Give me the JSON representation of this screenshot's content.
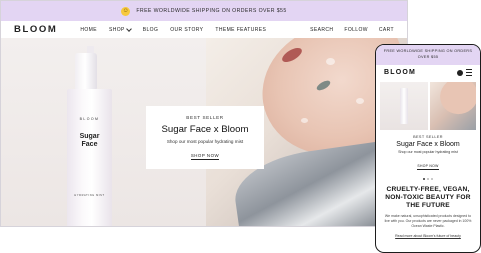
{
  "colors": {
    "announcement_bg": "#e3d5f3",
    "text": "#111111",
    "frame": "#1c1c1c"
  },
  "desktop": {
    "announcement": {
      "icon": "smile-emoji-icon",
      "text": "FREE WORLDWIDE SHIPPING ON ORDERS OVER $55"
    },
    "nav": {
      "logo": "BLOOM",
      "links": [
        "HOME",
        "SHOP",
        "BLOG",
        "OUR STORY",
        "THEME FEATURES"
      ],
      "right_links": [
        "SEARCH",
        "FOLLOW",
        "CART"
      ]
    },
    "product": {
      "brand": "BLOOM",
      "name_line1": "Sugar",
      "name_line2": "Face",
      "type": "HYDRATING MIST"
    },
    "hero": {
      "eyebrow": "BEST SELLER",
      "title": "Sugar Face x Bloom",
      "subtitle": "Shop our most popular hydrating mist",
      "cta": "SHOP NOW"
    }
  },
  "mobile": {
    "announcement": "FREE WORLDWIDE SHIPPING ON ORDERS OVER $55",
    "logo": "BLOOM",
    "hero": {
      "eyebrow": "BEST SELLER",
      "title": "Sugar Face x Bloom",
      "subtitle": "Shop our most popular hydrating mist",
      "cta": "SHOP NOW"
    },
    "heading": "CRUELTY-FREE, VEGAN, NON-TOXIC BEAUTY FOR THE FUTURE",
    "body": "We make natural, unsophisticated products designed to live with you. Our products are never packaged in 100% Ocean Waste Plastic.",
    "link_prefix": "Read more",
    "link_suffix": " about Bloom's future of beauty"
  }
}
